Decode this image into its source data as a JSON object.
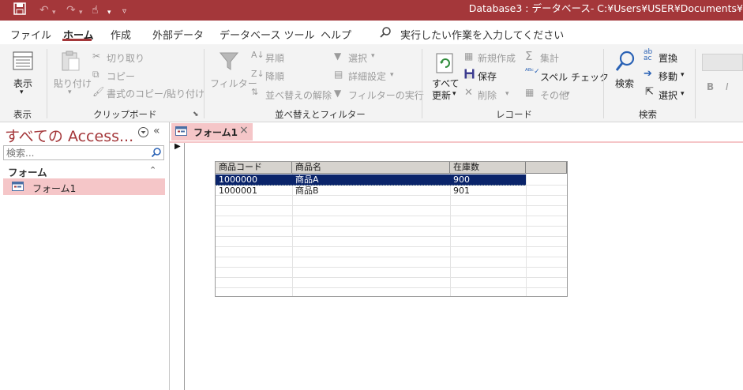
{
  "titlebar": {
    "title": "Database3 : データベース- C:¥Users¥USER¥Documents¥"
  },
  "menu": {
    "tabs": [
      "ファイル",
      "ホーム",
      "作成",
      "外部データ",
      "データベース ツール",
      "ヘルプ"
    ],
    "tellme": "実行したい作業を入力してください"
  },
  "ribbon": {
    "view": {
      "label": "表示",
      "group": "表示"
    },
    "clipboard": {
      "paste": "貼り付け",
      "cut": "切り取り",
      "copy": "コピー",
      "format_painter": "書式のコピー/貼り付け",
      "group": "クリップボード"
    },
    "sort_filter": {
      "filter": "フィルター",
      "ascending": "昇順",
      "descending": "降順",
      "remove_sort": "並べ替えの解除",
      "selection": "選択",
      "advanced": "詳細設定",
      "toggle_filter": "フィルターの実行",
      "group": "並べ替えとフィルター"
    },
    "records": {
      "refresh_line1": "すべて",
      "refresh_line2": "更新",
      "new": "新規作成",
      "save": "保存",
      "delete": "削除",
      "totals": "集計",
      "spelling": "スペル チェック",
      "more": "その他",
      "group": "レコード"
    },
    "find": {
      "find": "検索",
      "replace": "置換",
      "goto": "移動",
      "select": "選択",
      "group": "検索"
    },
    "text_format": {
      "bold": "B",
      "italic": "I"
    }
  },
  "nav": {
    "title": "すべての Access...",
    "search_placeholder": "検索...",
    "group": "フォーム",
    "items": [
      {
        "label": "フォーム1"
      }
    ]
  },
  "document": {
    "tab_label": "フォーム1"
  },
  "grid": {
    "columns": [
      "商品コード",
      "商品名",
      "在庫数"
    ],
    "rows": [
      [
        "1000000",
        "商品A",
        "900"
      ],
      [
        "1000001",
        "商品B",
        "901"
      ]
    ]
  },
  "colors": {
    "accent": "#a4373a",
    "selection": "#f5c6c8",
    "grid_selected": "#0a246a"
  }
}
